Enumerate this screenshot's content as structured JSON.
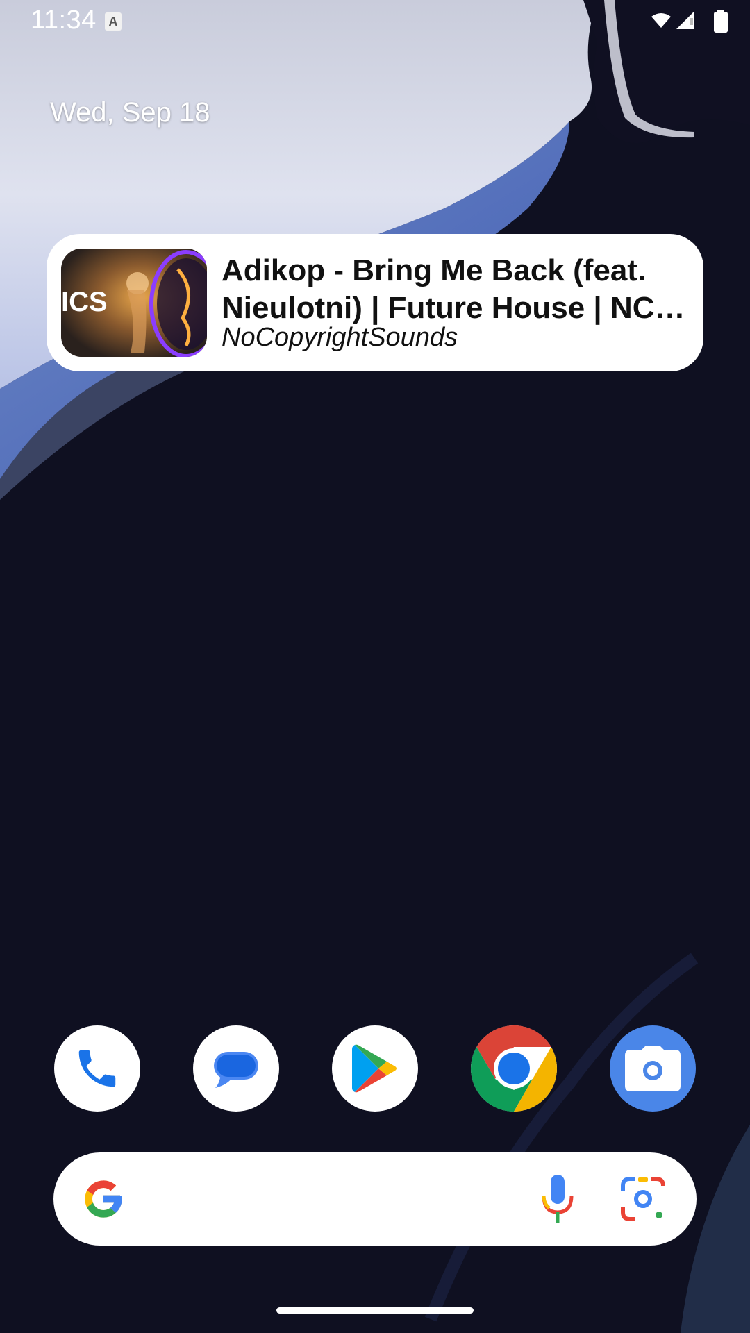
{
  "status_bar": {
    "time": "11:34",
    "notification_icon": "a-icon",
    "icons": [
      "wifi-icon",
      "cell-signal-icon",
      "battery-icon"
    ]
  },
  "date": "Wed, Sep 18",
  "media_widget": {
    "title": "Adikop - Bring Me Back (feat. Nieulotni) | Future House | NC…",
    "artist": "NoCopyrightSounds",
    "album_art_text": "ICS"
  },
  "dock": {
    "apps": [
      {
        "name": "Phone",
        "icon": "phone-icon"
      },
      {
        "name": "Messages",
        "icon": "messages-icon"
      },
      {
        "name": "Play Store",
        "icon": "play-store-icon"
      },
      {
        "name": "Chrome",
        "icon": "chrome-icon"
      },
      {
        "name": "Camera",
        "icon": "camera-icon"
      }
    ]
  },
  "search_bar": {
    "placeholder": "",
    "icons": [
      "google-g-icon",
      "mic-icon",
      "lens-icon"
    ]
  },
  "colors": {
    "google_blue": "#4285F4",
    "google_red": "#EA4335",
    "google_yellow": "#FBBC04",
    "google_green": "#34A853",
    "wallpaper_dark": "#0f1021"
  }
}
